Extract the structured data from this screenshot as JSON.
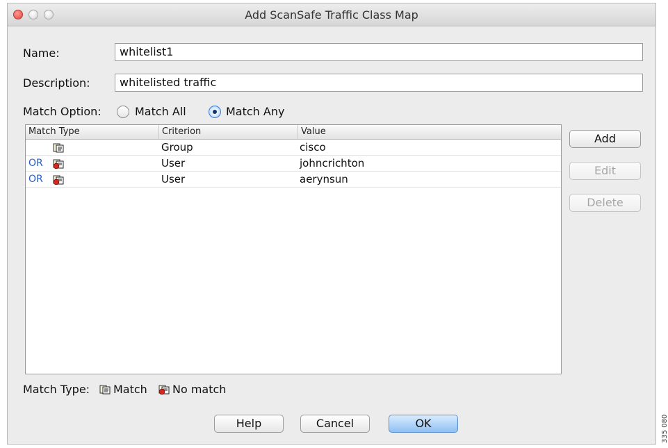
{
  "window": {
    "title": "Add ScanSafe Traffic Class Map"
  },
  "form": {
    "name_label": "Name:",
    "name_value": "whitelist1",
    "description_label": "Description:",
    "description_value": "whitelisted traffic",
    "match_option_label": "Match Option:",
    "match_all_label": "Match All",
    "match_any_label": "Match Any",
    "selected_option": "Match Any"
  },
  "table": {
    "headers": [
      "Match Type",
      "Criterion",
      "Value"
    ],
    "rows": [
      {
        "prefix": "",
        "match_icon": "match-icon",
        "criterion": "Group",
        "value": "cisco"
      },
      {
        "prefix": "OR",
        "match_icon": "no-match-icon",
        "criterion": "User",
        "value": "johncrichton"
      },
      {
        "prefix": "OR",
        "match_icon": "no-match-icon",
        "criterion": "User",
        "value": "aerynsun"
      }
    ]
  },
  "side_buttons": {
    "add": "Add",
    "edit": "Edit",
    "delete": "Delete"
  },
  "legend": {
    "label": "Match Type:",
    "match": "Match",
    "no_match": "No match"
  },
  "bottom_buttons": {
    "help": "Help",
    "cancel": "Cancel",
    "ok": "OK"
  },
  "colors": {
    "or_text": "#2a5fc7",
    "default_button": "#8fc0f2",
    "close_button": "#e0443e"
  },
  "figure_id": "335 080"
}
